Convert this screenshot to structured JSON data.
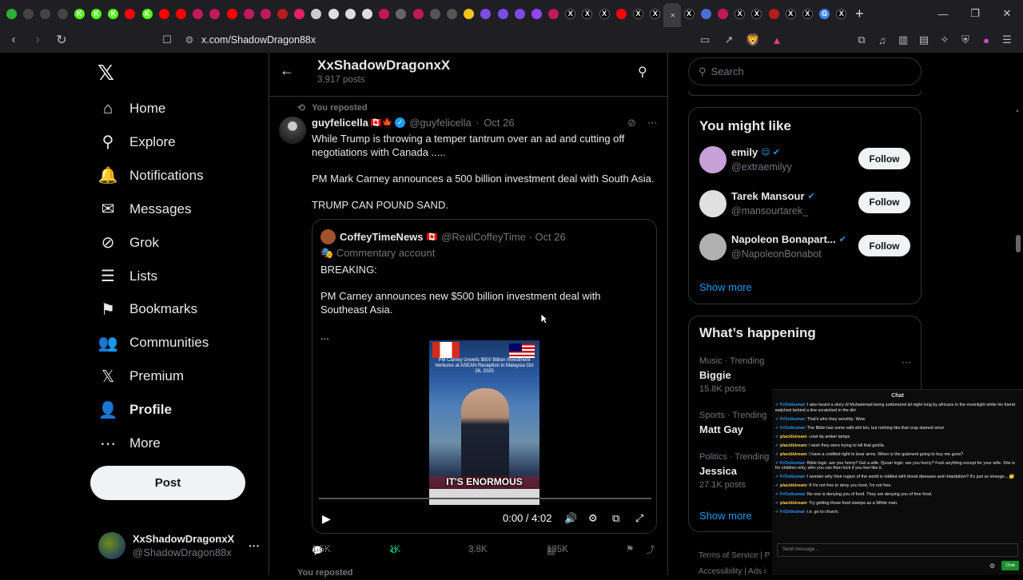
{
  "browser": {
    "tabs": [
      {
        "icon": "tab-icon",
        "color": "#2fae3a",
        "glyph": ""
      },
      {
        "icon": "tab-icon",
        "color": "#444",
        "glyph": ""
      },
      {
        "icon": "tab-icon",
        "color": "#444",
        "glyph": ""
      },
      {
        "icon": "tab-icon",
        "color": "#444",
        "glyph": ""
      },
      {
        "icon": "kick-icon",
        "color": "#53fc18",
        "glyph": "K"
      },
      {
        "icon": "kick-icon",
        "color": "#53fc18",
        "glyph": "K"
      },
      {
        "icon": "kick-icon",
        "color": "#53fc18",
        "glyph": "K"
      },
      {
        "icon": "youtube-icon",
        "color": "#ff0000",
        "glyph": ""
      },
      {
        "icon": "kick-icon",
        "color": "#53fc18",
        "glyph": "K"
      },
      {
        "icon": "youtube-icon",
        "color": "#ff0000",
        "glyph": ""
      },
      {
        "icon": "youtube-icon",
        "color": "#ff0000",
        "glyph": ""
      },
      {
        "icon": "tab-icon",
        "color": "#c2185b",
        "glyph": ""
      },
      {
        "icon": "tab-icon",
        "color": "#c2185b",
        "glyph": ""
      },
      {
        "icon": "youtube-icon",
        "color": "#ff0000",
        "glyph": ""
      },
      {
        "icon": "tab-icon",
        "color": "#c2185b",
        "glyph": ""
      },
      {
        "icon": "tab-icon",
        "color": "#c2185b",
        "glyph": ""
      },
      {
        "icon": "tab-icon",
        "color": "#b71c1c",
        "glyph": ""
      },
      {
        "icon": "tab-icon",
        "color": "#e91e63",
        "glyph": ""
      },
      {
        "icon": "tab-icon",
        "color": "#ccc",
        "glyph": ""
      },
      {
        "icon": "tab-icon",
        "color": "#ddd",
        "glyph": ""
      },
      {
        "icon": "tab-icon",
        "color": "#ddd",
        "glyph": ""
      },
      {
        "icon": "tab-icon",
        "color": "#ddd",
        "glyph": ""
      },
      {
        "icon": "tab-icon",
        "color": "#c2185b",
        "glyph": ""
      },
      {
        "icon": "tab-icon",
        "color": "#666",
        "glyph": ""
      },
      {
        "icon": "tab-icon",
        "color": "#c2185b",
        "glyph": ""
      },
      {
        "icon": "tab-icon",
        "color": "#555",
        "glyph": ""
      },
      {
        "icon": "tab-icon",
        "color": "#555",
        "glyph": ""
      },
      {
        "icon": "tab-icon",
        "color": "#f5c518",
        "glyph": ""
      },
      {
        "icon": "tab-icon",
        "color": "#7b4ce8",
        "glyph": ""
      },
      {
        "icon": "tab-icon",
        "color": "#7b4ce8",
        "glyph": ""
      },
      {
        "icon": "tab-icon",
        "color": "#7b4ce8",
        "glyph": ""
      },
      {
        "icon": "twitch-icon",
        "color": "#9146ff",
        "glyph": ""
      },
      {
        "icon": "tab-icon",
        "color": "#c2185b",
        "glyph": ""
      },
      {
        "icon": "x-icon",
        "color": "#000",
        "glyph": "X"
      },
      {
        "icon": "x-icon",
        "color": "#000",
        "glyph": "X"
      },
      {
        "icon": "x-icon",
        "color": "#000",
        "glyph": "X"
      },
      {
        "icon": "youtube-icon",
        "color": "#ff0000",
        "glyph": ""
      },
      {
        "icon": "x-icon",
        "color": "#000",
        "glyph": "X"
      },
      {
        "icon": "x-icon",
        "color": "#000",
        "glyph": "X"
      },
      {
        "icon": "x-icon",
        "color": "#000",
        "glyph": "X",
        "active": true
      },
      {
        "icon": "x-icon",
        "color": "#000",
        "glyph": "X"
      },
      {
        "icon": "tab-icon",
        "color": "#4a6fd1",
        "glyph": ""
      },
      {
        "icon": "tab-icon",
        "color": "#c2185b",
        "glyph": ""
      },
      {
        "icon": "x-icon",
        "color": "#000",
        "glyph": "X"
      },
      {
        "icon": "x-icon",
        "color": "#000",
        "glyph": "X"
      },
      {
        "icon": "tab-icon",
        "color": "#b71c1c",
        "glyph": ""
      },
      {
        "icon": "x-icon",
        "color": "#000",
        "glyph": "X"
      },
      {
        "icon": "x-icon",
        "color": "#000",
        "glyph": "X"
      },
      {
        "icon": "google-icon",
        "color": "#4285f4",
        "glyph": "G"
      },
      {
        "icon": "x-icon",
        "color": "#000",
        "glyph": "X"
      }
    ],
    "url": "x.com/ShadowDragon88x",
    "notification_badge": "1"
  },
  "nav": {
    "items": [
      {
        "label": "Home",
        "icon": "home-icon",
        "glyph": "⌂",
        "bold": false
      },
      {
        "label": "Explore",
        "icon": "search-icon",
        "glyph": "⚲",
        "bold": false
      },
      {
        "label": "Notifications",
        "icon": "bell-icon",
        "glyph": "🔔",
        "bold": false
      },
      {
        "label": "Messages",
        "icon": "mail-icon",
        "glyph": "✉",
        "bold": false
      },
      {
        "label": "Grok",
        "icon": "grok-icon",
        "glyph": "⊘",
        "bold": false
      },
      {
        "label": "Lists",
        "icon": "list-icon",
        "glyph": "☰",
        "bold": false
      },
      {
        "label": "Bookmarks",
        "icon": "bookmark-icon",
        "glyph": "⚑",
        "bold": false
      },
      {
        "label": "Communities",
        "icon": "communities-icon",
        "glyph": "👥",
        "bold": false
      },
      {
        "label": "Premium",
        "icon": "x-premium-icon",
        "glyph": "𝕏",
        "bold": false
      },
      {
        "label": "Profile",
        "icon": "person-icon",
        "glyph": "👤",
        "bold": true
      },
      {
        "label": "More",
        "icon": "more-circle-icon",
        "glyph": "⋯",
        "bold": false
      }
    ],
    "post_button": "Post",
    "account": {
      "name": "XxShadowDragonxX",
      "handle": "@ShadowDragon88x"
    }
  },
  "header": {
    "title": "XxShadowDragonxX",
    "subtitle": "3,917 posts"
  },
  "tweet": {
    "context": "You reposted",
    "author_name": "guyfelicella",
    "author_flags": "🇨🇦🍁",
    "author_handle": "@guyfelicella",
    "date": "Oct 26",
    "text": [
      "While Trump is throwing a temper tantrum over an ad and cutting off negotiations with Canada .....",
      "PM Mark Carney announces a 500 billion investment deal with South Asia.",
      "TRUMP CAN POUND SAND."
    ],
    "quote": {
      "author_name": "CoffeyTimeNews",
      "author_flag": "🇨🇦",
      "author_handle": "@RealCoffeyTime",
      "date": "Oct 26",
      "label": "Commentary account",
      "text": [
        "BREAKING:",
        "PM Carney announces new $500 billion investment deal with Southeast Asia.",
        "..."
      ],
      "video": {
        "caption": "PM Carney Unveils $500 Billion Investment Ventures at ASEAN Reception in Malaysia Oct 26, 2025",
        "overlay": "IT'S ENORMOUS ENORMOUS",
        "time": "0:00 / 4:02"
      }
    },
    "stats": {
      "replies": "1.5K",
      "reposts": "1K",
      "likes": "3.8K",
      "views": "135K"
    },
    "next_context": "You reposted"
  },
  "sidebar": {
    "search_placeholder": "Search",
    "who_to_follow": {
      "title": "You might like",
      "users": [
        {
          "name": "emily",
          "badges": "😌 ✔",
          "handle": "@extraemilyy",
          "color": "#c8a0d8"
        },
        {
          "name": "Tarek Mansour",
          "badges": "✔",
          "handle": "@mansourtarek_",
          "color": "#e0e0e0"
        },
        {
          "name": "Napoleon Bonapart...",
          "badges": "✔",
          "handle": "@NapoleonBonabot",
          "color": "#b0b0b0"
        }
      ],
      "follow_label": "Follow",
      "show_more": "Show more"
    },
    "trending": {
      "title": "What’s happening",
      "items": [
        {
          "category": "Music · Trending",
          "topic": "Biggie",
          "posts": "15.8K posts"
        },
        {
          "category": "Sports · Trending",
          "topic": "Matt Gay",
          "posts": ""
        },
        {
          "category": "Politics · Trending",
          "topic": "Jessica",
          "posts": "27.1K posts"
        }
      ],
      "show_more": "Show more"
    },
    "footer": {
      "line1": "Terms of Service  |  P",
      "line2": "Accessibility  |  Ads i"
    }
  },
  "chat": {
    "title": "Chat",
    "messages": [
      {
        "user": "FrOstbumar",
        "text": ": I also heard a story of Muhammad being sodomized all night long by africans in the moonlight while his friend watched behind a line scratched in the dirt"
      },
      {
        "user": "FrOstbumar",
        "text": ": That's who they worship. Wow"
      },
      {
        "user": "FrOstbumar",
        "text": ": The Bible has some wild shit too, but nothing like that crap stained smut"
      },
      {
        "user": "placidstream",
        "text": ": cowl da amber lamps"
      },
      {
        "user": "placidstream",
        "text": ": I wish they were trying to kill that gorilla"
      },
      {
        "user": "placidstream",
        "text": ": I have a codified right to bear arms. When is the gubment going to buy me guns?"
      },
      {
        "user": "FrOstbumar",
        "text": ": Bible logic: are you horny? Get a wife. Quran logic: are you horny? Fuck anything except for your wife. She is for children only, who you can then fuck if you feel like it."
      },
      {
        "user": "FrOstbumar",
        "text": ": I wonder why their region of the world is riddled with blood diseases and retardation? It's just so strange... 🤔"
      },
      {
        "user": "placidstream",
        "text": ": If i'm not free to deny you food, I'm not free."
      },
      {
        "user": "FrOstbumar",
        "text": ": No one is denying you of food. They are denying you of free food."
      },
      {
        "user": "placidstream",
        "text": ": Try getting those food stamps as a White man."
      },
      {
        "user": "FrOstbumar",
        "text": ": i.e. go to church."
      }
    ],
    "input_placeholder": "Send message...",
    "send_label": "Chat",
    "user_color_a": "#1d9bf0",
    "user_color_b": "#ffd24d"
  },
  "colors": {
    "accent": "#1d9bf0",
    "repost_green": "#00ba7c",
    "bg": "#000000",
    "border": "#2f3336"
  }
}
